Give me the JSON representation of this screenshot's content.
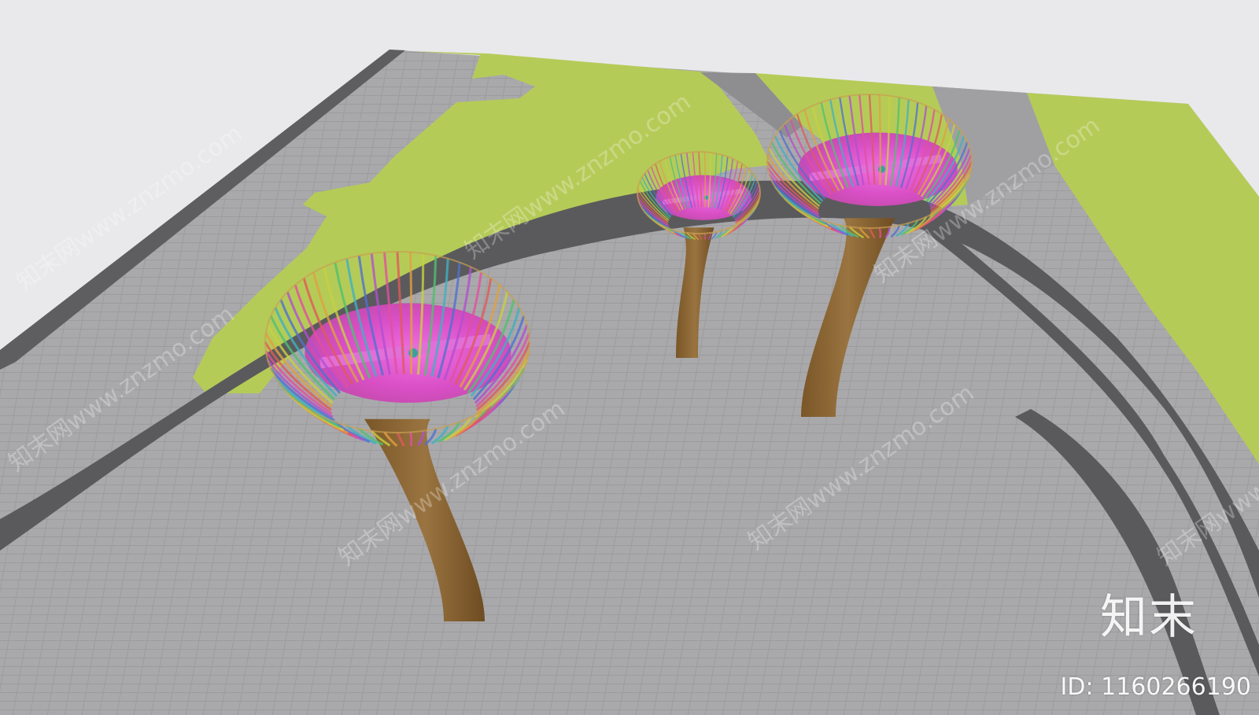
{
  "scene": {
    "type": "3d-model-preview",
    "description_items": [
      "paved-plaza",
      "lawn-areas",
      "asphalt-paths",
      "tree-canopy-sculptures"
    ],
    "sculpture_count": 3
  },
  "colors": {
    "background": "#e9e9ec",
    "paving": "#a8a8aa",
    "paving_joint": "#9a9a9c",
    "asphalt": "#5a5a5c",
    "lawn": "#b3c955",
    "trunk": "#8a6535",
    "canopy_inner": "#e055cc"
  },
  "watermark": {
    "logo_text": "知末",
    "id_text": "ID: 1160266190",
    "tiled_text": "知末网www.znzmo.com"
  }
}
